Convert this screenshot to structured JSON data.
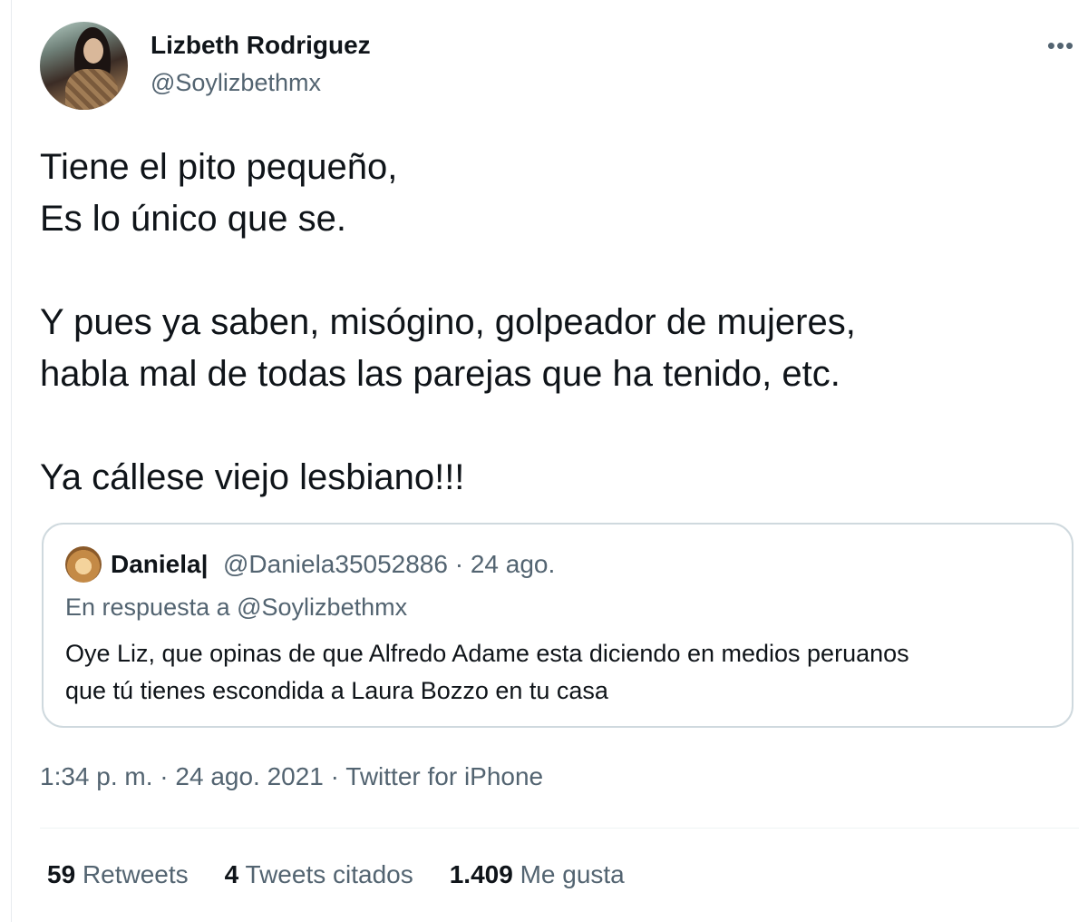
{
  "author": {
    "display_name": "Lizbeth Rodriguez",
    "handle": "@Soylizbethmx"
  },
  "tweet": {
    "lines": [
      "Tiene el pito pequeño,",
      "Es lo único que se.",
      "Y pues ya saben, misógino, golpeador de mujeres,",
      "habla mal de todas las parejas que ha tenido, etc.",
      "Ya cállese viejo lesbiano!!!"
    ]
  },
  "quoted_tweet": {
    "display_name": "Daniela|",
    "meta": "@Daniela35052886 · 24 ago.",
    "reply_to": "En respuesta a @Soylizbethmx",
    "text_lines": [
      "Oye Liz, que opinas de que Alfredo Adame esta diciendo en medios peruanos",
      "que tú tienes escondida a Laura Bozzo en tu casa"
    ]
  },
  "timestamp": "1:34 p. m. · 24 ago. 2021 · Twitter for iPhone",
  "stats": {
    "retweets_count": "59",
    "retweets_label": "Retweets",
    "quotes_count": "4",
    "quotes_label": "Tweets citados",
    "likes_count": "1.409",
    "likes_label": "Me gusta"
  },
  "icons": {
    "more": "more-horizontal-icon"
  },
  "colors": {
    "text": "#0f1419",
    "secondary": "#536471",
    "border": "#cfd9de"
  }
}
